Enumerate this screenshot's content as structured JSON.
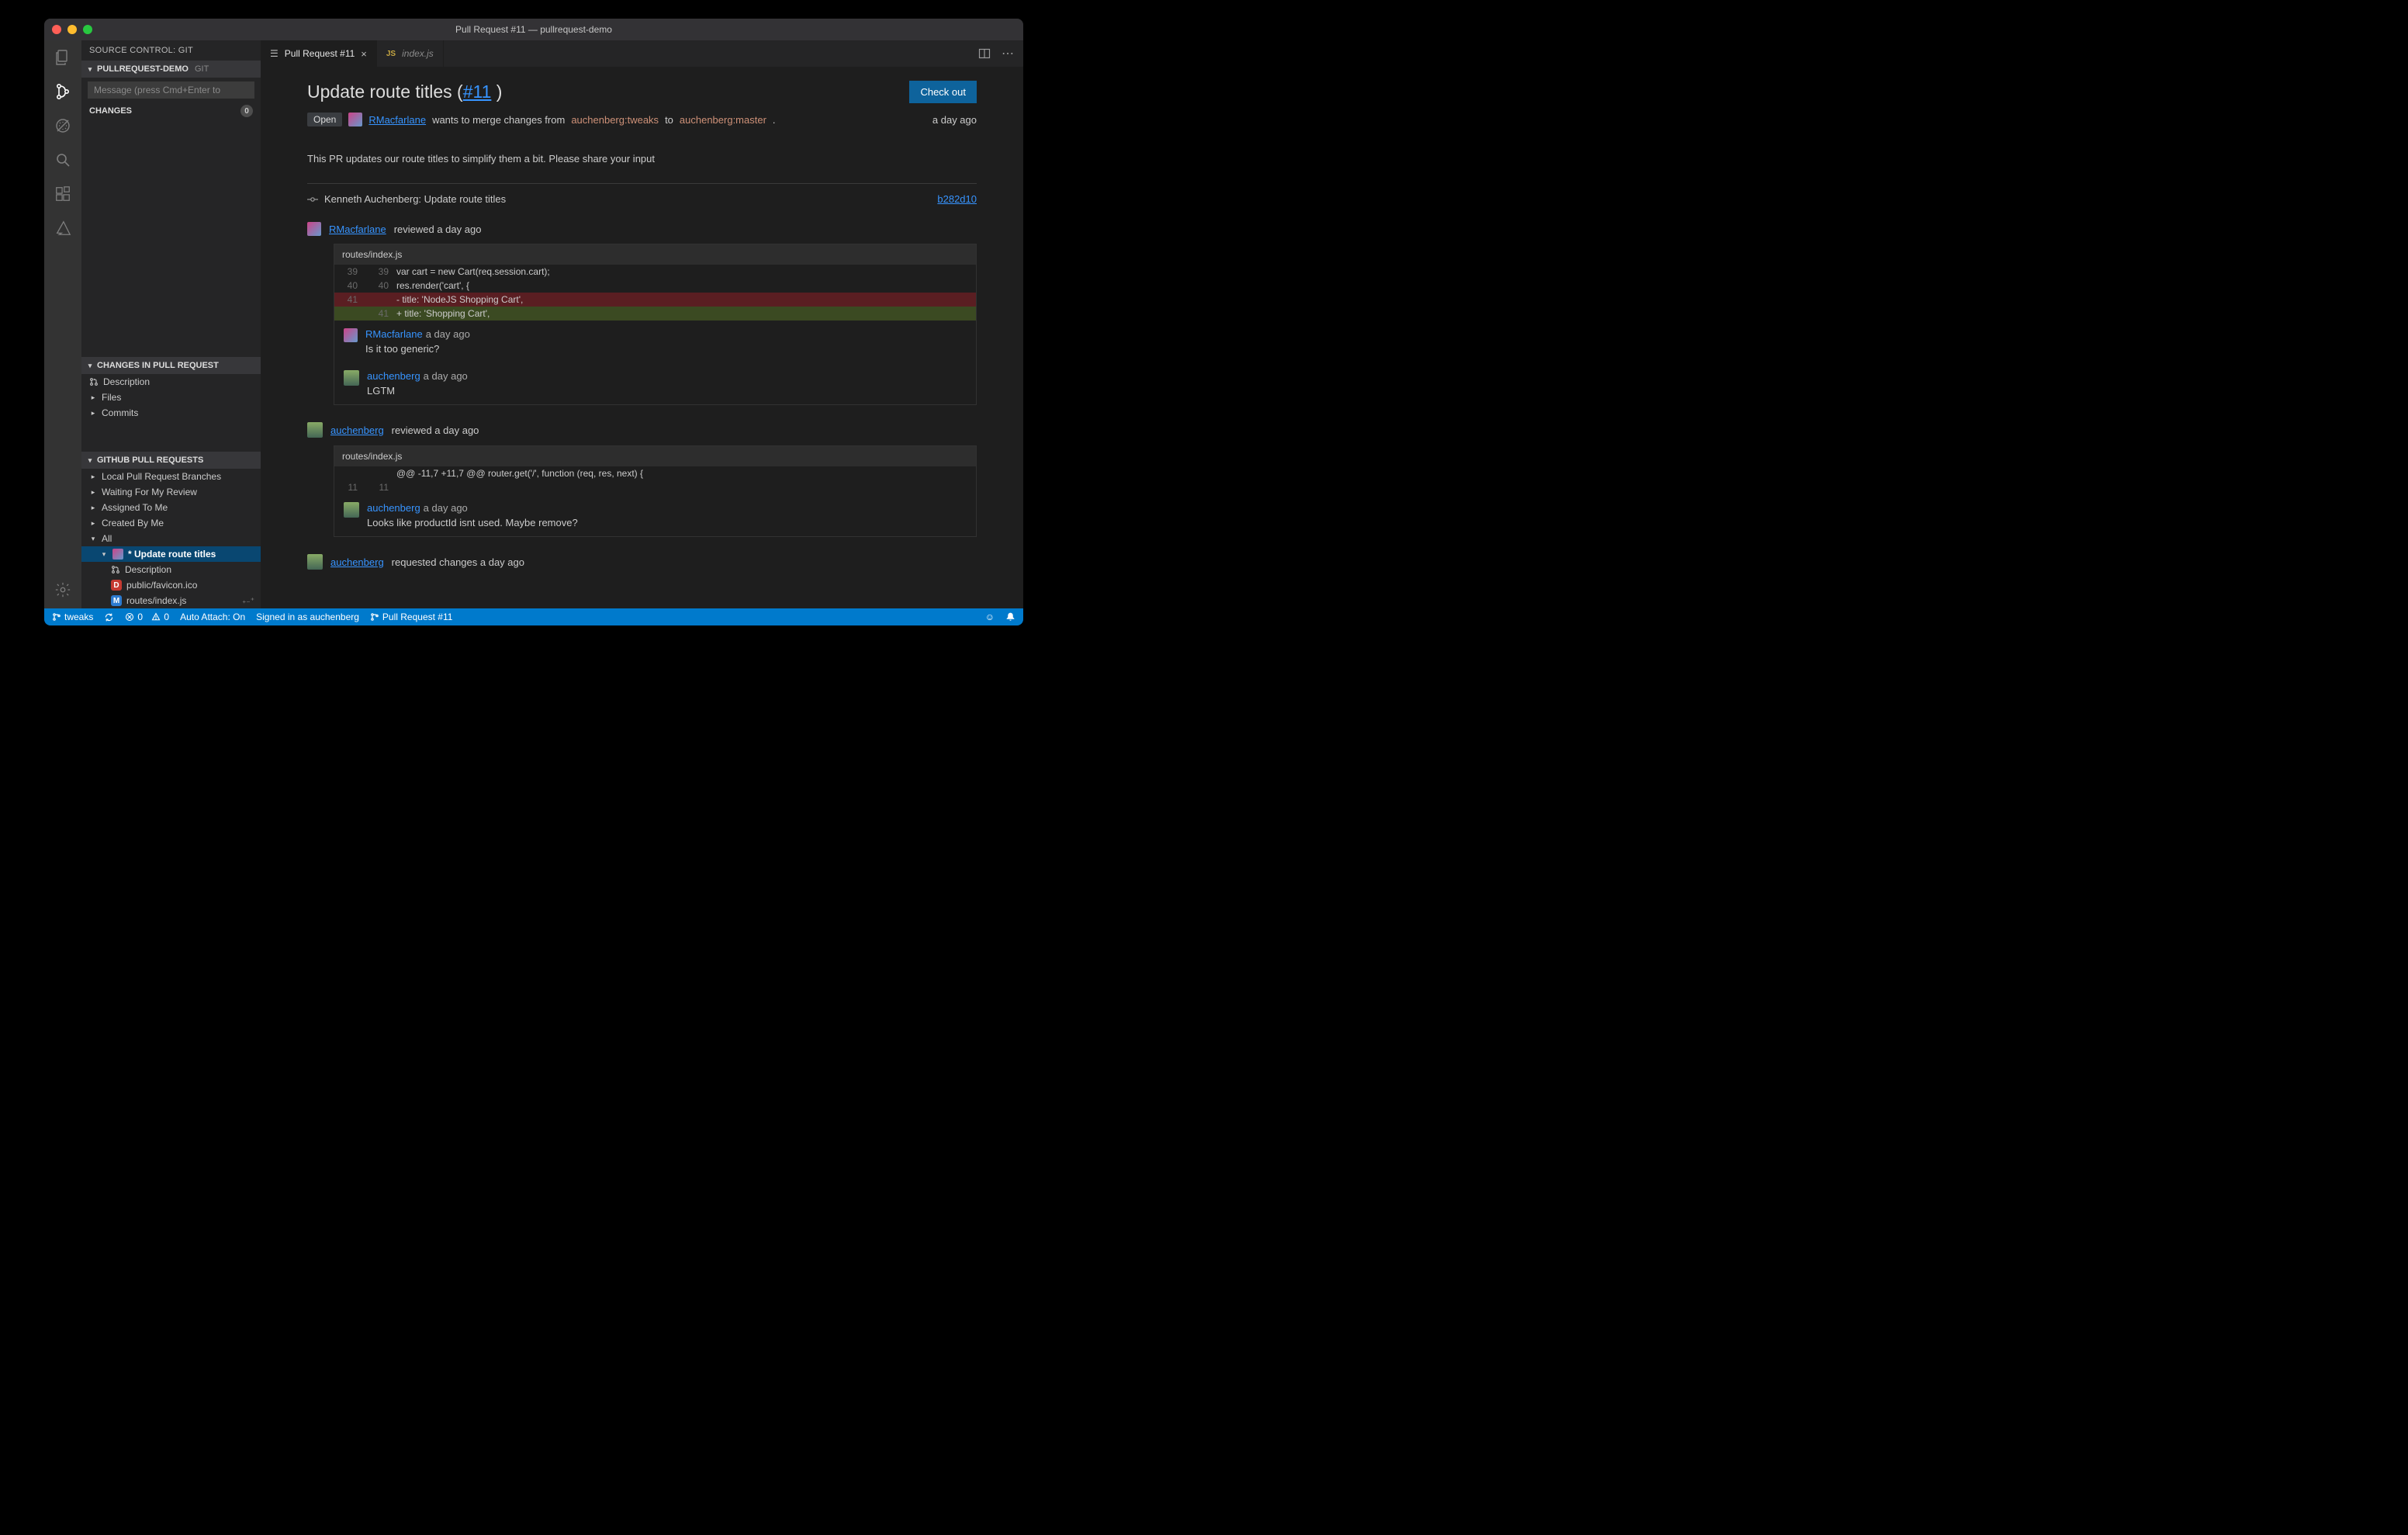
{
  "window_title": "Pull Request #11 — pullrequest-demo",
  "activitybar": {
    "icons": [
      "files",
      "scm",
      "debug-off",
      "search",
      "extensions",
      "azure"
    ],
    "bottom": "gear"
  },
  "sidebar": {
    "title": "SOURCE CONTROL: GIT",
    "repo_header": "PULLREQUEST-DEMO",
    "repo_kind": "GIT",
    "message_placeholder": "Message (press Cmd+Enter to",
    "changes_label": "CHANGES",
    "changes_count": "0",
    "pr_changes_header": "CHANGES IN PULL REQUEST",
    "pr_changes_items": [
      "Description",
      "Files",
      "Commits"
    ],
    "gh_header": "GITHUB PULL REQUESTS",
    "gh_items": [
      {
        "l": "Local Pull Request Branches",
        "exp": false,
        "d": 0
      },
      {
        "l": "Waiting For My Review",
        "exp": false,
        "d": 0
      },
      {
        "l": "Assigned To Me",
        "exp": false,
        "d": 0
      },
      {
        "l": "Created By Me",
        "exp": false,
        "d": 0
      },
      {
        "l": "All",
        "exp": true,
        "d": 0
      }
    ],
    "sel_pr": "* Update route titles",
    "sel_children": [
      {
        "ico": "pr",
        "label": "Description"
      },
      {
        "ico": "D",
        "label": "public/favicon.ico"
      },
      {
        "ico": "M",
        "label": "routes/index.js",
        "deco": "₊₋⁺"
      }
    ]
  },
  "tabs": [
    {
      "icon": "list",
      "label": "Pull Request #11",
      "active": true,
      "close": true
    },
    {
      "icon": "js",
      "label": "index.js",
      "active": false,
      "close": false,
      "italic": true
    }
  ],
  "pr": {
    "title_prefix": "Update route titles (",
    "title_num": "#11",
    "title_suffix": " )",
    "checkout": "Check out",
    "state": "Open",
    "author": "RMacfarlane",
    "merge_1": " wants to merge changes from ",
    "branch_from": "auchenberg:tweaks",
    "merge_2": " to ",
    "branch_to": "auchenberg:master",
    "dot": ".",
    "ago": "a day ago",
    "description": "This PR updates our route titles to simplify them a bit. Please share your input",
    "commit": {
      "label": "Kenneth Auchenberg: Update route titles",
      "sha": "b282d10"
    }
  },
  "reviews": [
    {
      "user": "RMacfarlane",
      "verb": "reviewed a day ago",
      "file": "routes/index.js",
      "lines": [
        {
          "ol": "39",
          "nl": "39",
          "t": "var cart = new Cart(req.session.cart);",
          "c": ""
        },
        {
          "ol": "40",
          "nl": "40",
          "t": "res.render('cart', {",
          "c": ""
        },
        {
          "ol": "41",
          "nl": "",
          "t": "- title: 'NodeJS Shopping Cart',",
          "c": "del"
        },
        {
          "ol": "",
          "nl": "41",
          "t": "+ title: 'Shopping Cart',",
          "c": "add"
        }
      ],
      "comments": [
        {
          "who": "RMacfarlane",
          "when": "a day ago",
          "txt": "Is it too generic?"
        },
        {
          "who": "auchenberg",
          "when": "a day ago",
          "txt": "LGTM"
        }
      ]
    },
    {
      "user": "auchenberg",
      "verb": "reviewed a day ago",
      "file": "routes/index.js",
      "lines": [
        {
          "ol": "",
          "nl": "",
          "t": "@@ -11,7 +11,7 @@ router.get('/', function (req, res, next) {",
          "c": ""
        },
        {
          "ol": "11",
          "nl": "11",
          "t": "",
          "c": ""
        }
      ],
      "comments": [
        {
          "who": "auchenberg",
          "when": "a day ago",
          "txt": "Looks like productId isnt used. Maybe remove?"
        }
      ]
    }
  ],
  "final_review": {
    "user": "auchenberg",
    "verb": "requested changes a day ago"
  },
  "statusbar": {
    "branch": "tweaks",
    "sync": "",
    "errors": "0",
    "warnings": "0",
    "auto_attach": "Auto Attach: On",
    "signed": "Signed in as auchenberg",
    "pr": "Pull Request #11"
  }
}
